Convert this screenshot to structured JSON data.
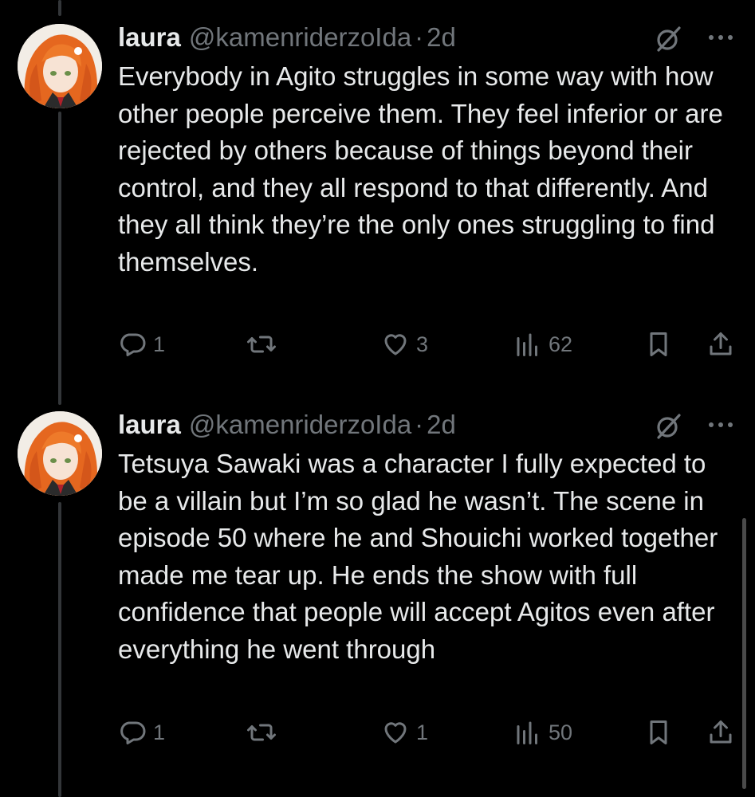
{
  "tweets": [
    {
      "name": "laura",
      "handle": "@kamenriderzoIda",
      "separator": "·",
      "time": "2d",
      "text": "Everybody in Agito struggles in some way with how other people perceive them. They feel inferior or are rejected by others because of things beyond their control, and they all respond to that differently. And they all think they’re the only ones struggling to find themselves.",
      "replies": "1",
      "likes": "3",
      "views": "62"
    },
    {
      "name": "laura",
      "handle": "@kamenriderzoIda",
      "separator": "·",
      "time": "2d",
      "text": "Tetsuya Sawaki was a character I fully expected to be a villain but I’m so glad he wasn’t. The scene in episode 50 where he and Shouichi worked together made me tear up. He ends the show with full confidence that people will accept Agitos even after everything he went through",
      "replies": "1",
      "likes": "1",
      "views": "50"
    }
  ],
  "icons": {
    "reply": "reply-icon",
    "retweet": "retweet-icon",
    "like": "heart-icon",
    "views": "views-icon",
    "bookmark": "bookmark-icon",
    "share": "share-icon",
    "grok": "grok-icon",
    "more": "more-icon"
  },
  "colors": {
    "background": "#000000",
    "text": "#e7e9ea",
    "muted": "#71767b",
    "thread_line": "#333639"
  }
}
